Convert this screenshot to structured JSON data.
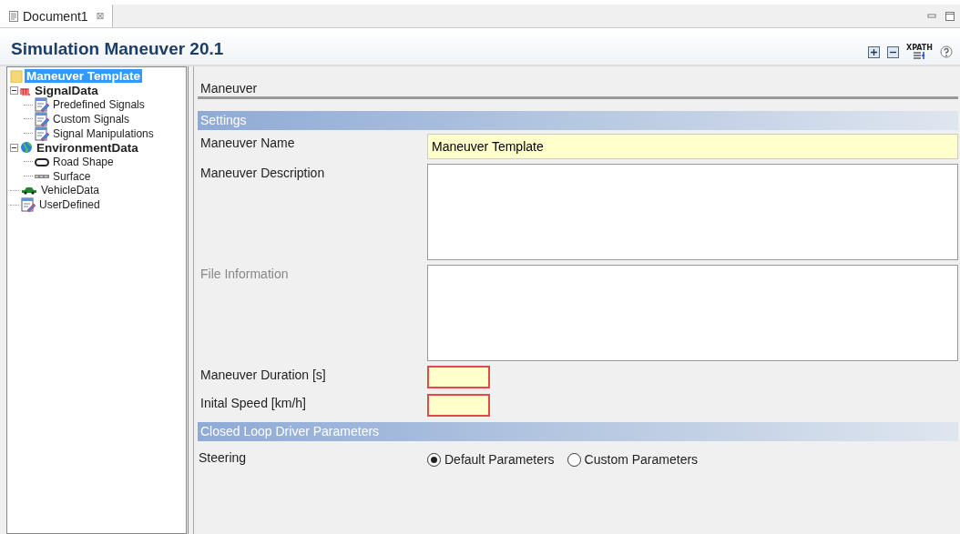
{
  "tab": {
    "label": "Document1",
    "close": "⊠"
  },
  "title": "Simulation Maneuver 20.1",
  "toolbar": {
    "xpath_label": "XPATH"
  },
  "tree": [
    {
      "label": "Maneuver Template",
      "kind": "folder",
      "bold": true,
      "selected": true
    },
    {
      "label": "SignalData",
      "kind": "signal",
      "bold": true,
      "selected": false,
      "expanded": true,
      "children": [
        {
          "label": "Predefined Signals",
          "kind": "doc",
          "bold": false,
          "selected": false
        },
        {
          "label": "Custom Signals",
          "kind": "doc",
          "bold": false,
          "selected": false
        },
        {
          "label": "Signal Manipulations",
          "kind": "doc",
          "bold": false,
          "selected": false
        }
      ]
    },
    {
      "label": "EnvironmentData",
      "kind": "globe",
      "bold": true,
      "selected": false,
      "expanded": true,
      "children": [
        {
          "label": "Road Shape",
          "kind": "road",
          "bold": false,
          "selected": false
        },
        {
          "label": "Surface",
          "kind": "surface",
          "bold": false,
          "selected": false
        }
      ]
    },
    {
      "label": "VehicleData",
      "kind": "car",
      "bold": false,
      "selected": false
    },
    {
      "label": "UserDefined",
      "kind": "doc",
      "bold": false,
      "selected": false
    }
  ],
  "form": {
    "heading": "Maneuver",
    "sections": [
      {
        "title": "Settings",
        "rows": [
          {
            "label": "Maneuver Name",
            "kind": "text",
            "value": "Maneuver Template",
            "disabled": false,
            "invalid": false
          },
          {
            "label": "Maneuver Description",
            "kind": "area",
            "disabled": false,
            "invalid": false
          },
          {
            "label": "File Information",
            "kind": "area",
            "disabled": true,
            "invalid": false
          },
          {
            "label": "Maneuver Duration [s]",
            "kind": "short",
            "disabled": false,
            "invalid": true
          },
          {
            "label": "Inital Speed [km/h]",
            "kind": "short",
            "disabled": false,
            "invalid": true
          }
        ]
      },
      {
        "title": "Closed Loop Driver Parameters",
        "rows": [
          {
            "label": "Steering",
            "kind": "radio",
            "options": [
              {
                "label": "Default Parameters",
                "selected": true
              },
              {
                "label": "Custom Parameters",
                "selected": false
              }
            ]
          }
        ]
      }
    ]
  }
}
